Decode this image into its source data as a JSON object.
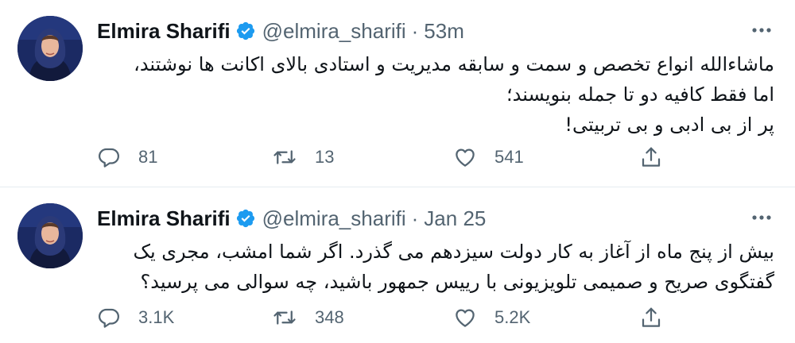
{
  "tweets": [
    {
      "author_name": "Elmira Sharifi",
      "handle": "@elmira_sharifi",
      "separator": "·",
      "time": "53m",
      "lines": [
        "ماشاءالله انواع تخصص و سمت و سابقه مدیریت و استادی بالای اکانت ها نوشتند،",
        "اما فقط کافیه دو تا جمله بنویسند؛",
        "پر از بی ادبی و بی تربیتی!"
      ],
      "replies": "81",
      "retweets": "13",
      "likes": "541"
    },
    {
      "author_name": "Elmira Sharifi",
      "handle": "@elmira_sharifi",
      "separator": "·",
      "time": "Jan 25",
      "lines": [
        "بیش از پنج ماه از آغاز به کار دولت سیزدهم می گذرد. اگر شما امشب، مجری یک",
        "گفتگوی صریح و صمیمی تلویزیونی با رییس جمهور باشید، چه سوالی می پرسید؟"
      ],
      "replies": "3.1K",
      "retweets": "348",
      "likes": "5.2K"
    }
  ],
  "icons": {
    "verified": "verified-badge-icon",
    "more": "more-options-icon",
    "reply": "reply-icon",
    "retweet": "retweet-icon",
    "like": "heart-icon",
    "share": "share-icon"
  },
  "colors": {
    "verified_blue": "#1d9bf0",
    "secondary_text": "#536471",
    "divider": "#e6ecf0"
  }
}
